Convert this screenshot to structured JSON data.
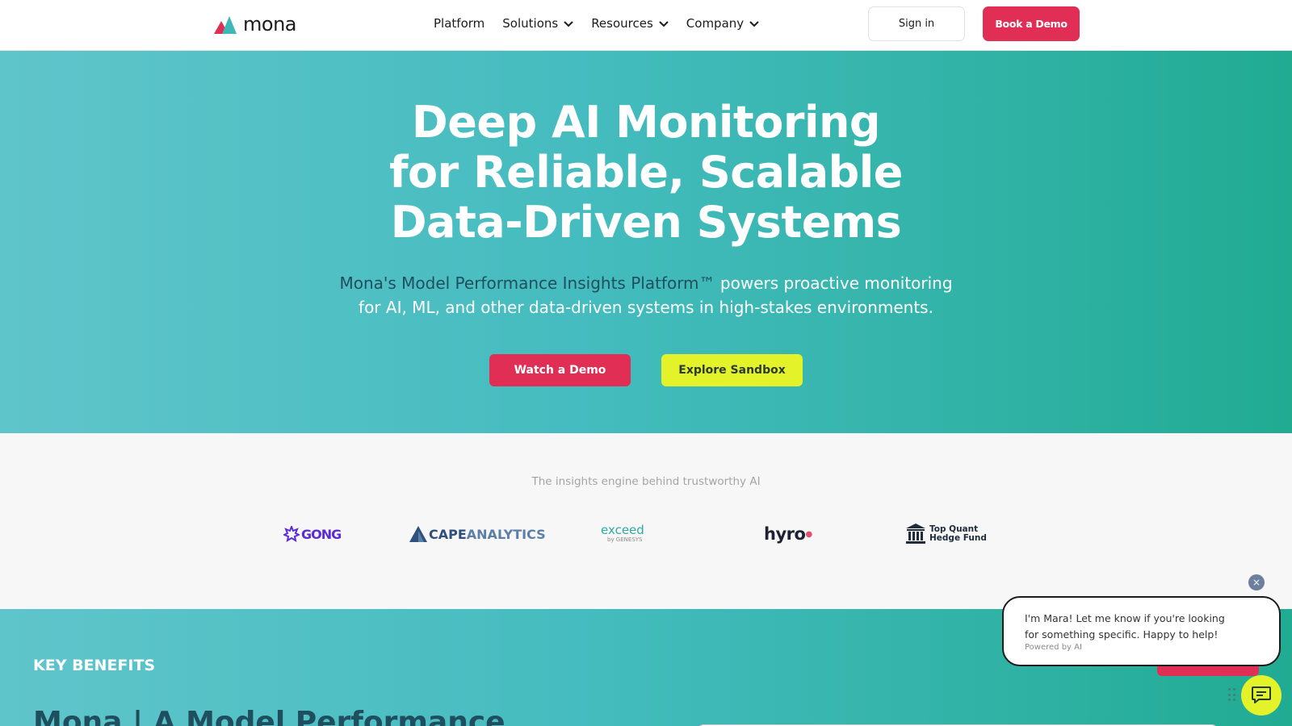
{
  "brand": {
    "name": "mona"
  },
  "nav": {
    "items": [
      {
        "label": "Platform",
        "dropdown": false
      },
      {
        "label": "Solutions",
        "dropdown": true
      },
      {
        "label": "Resources",
        "dropdown": true
      },
      {
        "label": "Company",
        "dropdown": true
      }
    ],
    "signin_label": "Sign in",
    "book_label": "Book a Demo"
  },
  "hero": {
    "title_lines": [
      "Deep AI Monitoring",
      "for Reliable, Scalable",
      "Data-Driven Systems"
    ],
    "subtitle_dark": "Mona's Model Performance Insights Platform™",
    "subtitle_rest": " powers proactive monitoring",
    "subtitle_line2": "for AI, ML, and other data-driven systems in high-stakes environments.",
    "watch_label": "Watch a Demo",
    "sandbox_label": "Explore Sandbox"
  },
  "customers": {
    "title": "The insights engine behind trustworthy AI",
    "logos": {
      "gong": "GONG",
      "cape_bold": "CAPE",
      "cape_light": "ANALYTICS",
      "exceed": "exceed",
      "exceed_by": "by GENESYS",
      "hyro": "hyro",
      "tqhf_line1": "Top Quant",
      "tqhf_line2": "Hedge Fund"
    }
  },
  "benefits": {
    "label": "KEY BENEFITS",
    "heading": "Mona | A Model Performance"
  },
  "chat": {
    "close_symbol": "×",
    "message": "I'm Mara! Let me know if you're looking for something specific. Happy to help!",
    "powered": "Powered by AI"
  },
  "colors": {
    "accent_pink": "#e02e55",
    "accent_lime": "#e4f22a",
    "teal_start": "#5fc5cb",
    "teal_end": "#21ab93",
    "dark_teal_text": "#1f4f5f"
  },
  "icons": [
    "chevron-down-icon",
    "bank-icon",
    "chat-icon",
    "close-icon",
    "drag-handle-icon"
  ]
}
